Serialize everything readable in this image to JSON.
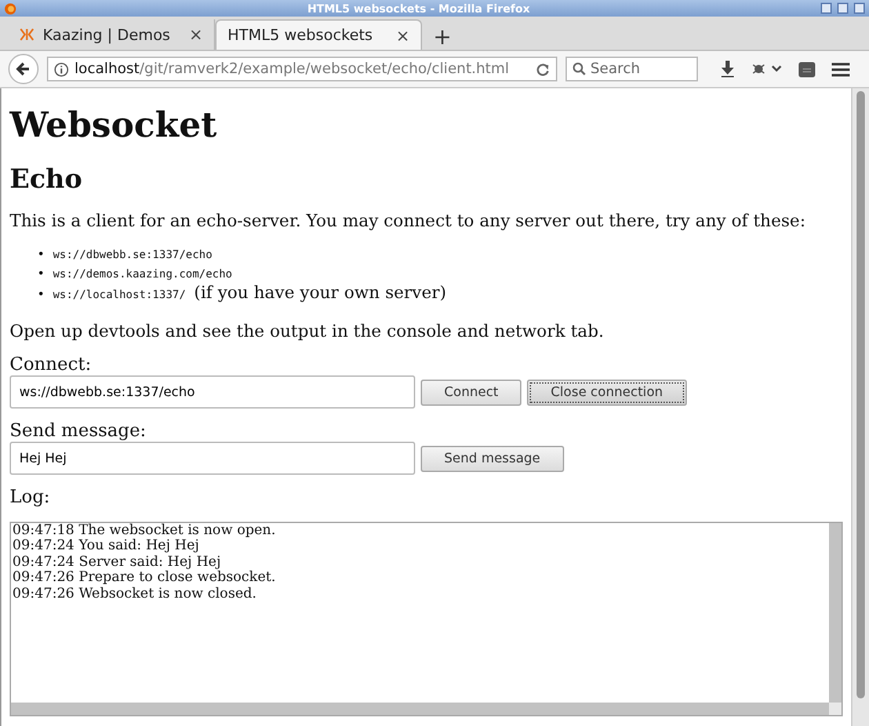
{
  "window": {
    "title": "HTML5 websockets - Mozilla Firefox"
  },
  "tabs": [
    {
      "label": "Kaazing | Demos",
      "selected": false,
      "close": "×"
    },
    {
      "label": "HTML5 websockets",
      "selected": true,
      "close": "×"
    }
  ],
  "new_tab": "+",
  "address": {
    "host": "localhost",
    "path": "/git/ramverk2/example/websocket/echo/client.html"
  },
  "search": {
    "placeholder": "Search"
  },
  "page": {
    "heading": "Websocket",
    "subheading": "Echo",
    "intro": "This is a client for an echo-server. You may connect to any server out there, try any of these:",
    "servers": [
      {
        "bullet": "•",
        "url": "ws://dbwebb.se:1337/echo"
      },
      {
        "bullet": "•",
        "url": "ws://demos.kaazing.com/echo"
      },
      {
        "bullet": "•",
        "url": "ws://localhost:1337/",
        "note": "(if you have your own server)"
      }
    ],
    "hint": "Open up devtools and see the output in the console and network tab.",
    "connect": {
      "label": "Connect:",
      "value": "ws://dbwebb.se:1337/echo",
      "buttons": [
        {
          "label": "Connect",
          "focused": false
        },
        {
          "label": "Close connection",
          "focused": true
        }
      ]
    },
    "send": {
      "label": "Send message:",
      "value": "Hej Hej",
      "buttons": [
        {
          "label": "Send message",
          "focused": false
        }
      ]
    },
    "log": {
      "label": "Log:",
      "lines": [
        "09:47:18 The websocket is now open.",
        "09:47:24 You said: Hej Hej",
        "09:47:24 Server said: Hej Hej",
        "09:47:26 Prepare to close websocket.",
        "09:47:26 Websocket is now closed."
      ]
    }
  }
}
